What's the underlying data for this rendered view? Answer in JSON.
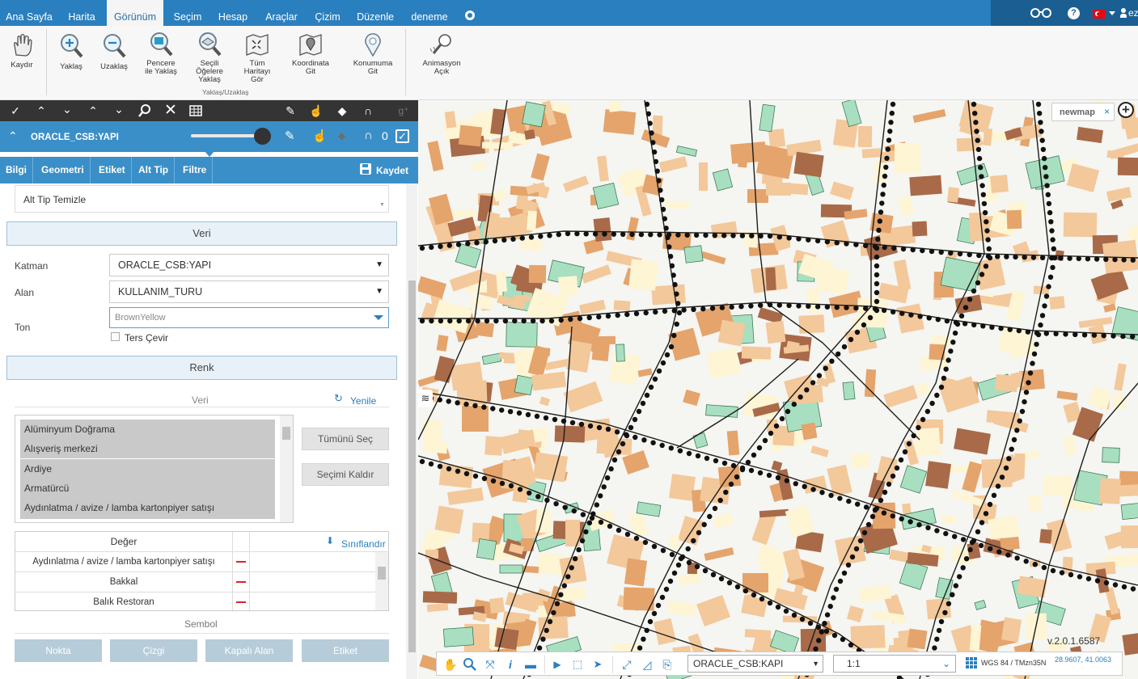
{
  "nav": {
    "tabs": [
      "Ana Sayfa",
      "Harita",
      "Görünüm",
      "Seçim",
      "Hesap",
      "Araçlar",
      "Çizim",
      "Düzenle",
      "deneme"
    ],
    "active_tab": "Görünüm",
    "user": "ezgi",
    "icons": [
      "glasses-icon",
      "help-icon",
      "flag-tr-icon",
      "user-icon"
    ]
  },
  "ribbon": {
    "pan": "Kaydır",
    "zoom_in": "Yaklaş",
    "zoom_out": "Uzaklaş",
    "window_zoom": [
      "Pencere",
      "ile Yaklaş"
    ],
    "zoom_selected": [
      "Seçili",
      "Öğelere",
      "Yaklaş"
    ],
    "full_map": [
      "Tüm",
      "Haritayı",
      "Gör"
    ],
    "coord_go": [
      "Koordinata",
      "Git"
    ],
    "location_go": [
      "Konumuma",
      "Git"
    ],
    "animation": [
      "Animasyon",
      "Açık"
    ],
    "group_label": "Yaklaş/Uzaklaş"
  },
  "layer": {
    "name": "ORACLE_CSB:YAPI",
    "count": "0",
    "tabs": [
      "Bilgi",
      "Geometri",
      "Etiket",
      "Alt Tip",
      "Filtre"
    ],
    "save": "Kaydet"
  },
  "panel": {
    "subtype_clear": "Alt Tip Temizle",
    "data_header": "Veri",
    "katman_label": "Katman",
    "katman_value": "ORACLE_CSB:YAPI",
    "alan_label": "Alan",
    "alan_value": "KULLANIM_TURU",
    "ton_label": "Ton",
    "ton_value": "BrownYellow",
    "invert_label": "Ters Çevir",
    "renk_header": "Renk",
    "veri_sub": "Veri",
    "refresh": "Yenile",
    "list_items": [
      "Alüminyum Doğrama",
      "Alışveriş merkezi",
      "Ardiye",
      "Armatürcü",
      "Aydınlatma / avize / lamba kartonpiyer satışı"
    ],
    "select_all": "Tümünü Seç",
    "deselect": "Seçimi Kaldır",
    "value_col": "Değer",
    "classify": "Sınıflandır",
    "value_rows": [
      "Aydınlatma / avize / lamba kartonpiyer satışı",
      "Bakkal",
      "Balık Restoran"
    ],
    "symbol_header": "Sembol",
    "symbol_buttons": [
      "Nokta",
      "Çizgi",
      "Kapalı Alan",
      "Etiket"
    ]
  },
  "map": {
    "tab_name": "newmap",
    "version": "v.2.0.1.6587",
    "layer_select": "ORACLE_CSB:KAPI",
    "scale": "1:1",
    "crs": "WGS 84 / TMzn35N",
    "coords": "28.9607, 41.0063",
    "colors": {
      "light_yellow": "#fdf5d4",
      "peach": "#f3c89a",
      "tan": "#e4a46c",
      "brown": "#a86a48",
      "green": "#a8dfc0",
      "road": "#222222"
    }
  }
}
